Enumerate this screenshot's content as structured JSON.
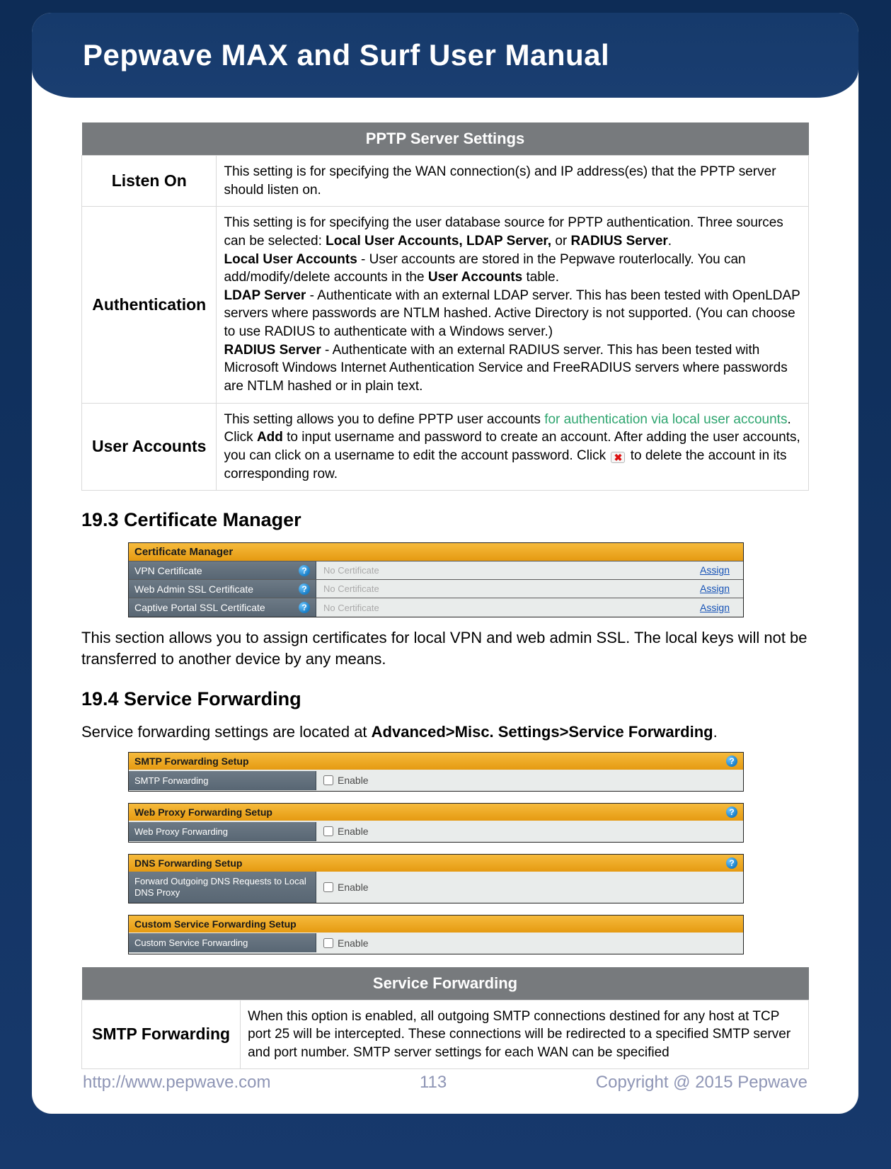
{
  "header": {
    "title": "Pepwave MAX and Surf User Manual"
  },
  "pptp_table": {
    "title": "PPTP Server Settings",
    "rows": {
      "listen_on": {
        "label": "Listen On",
        "text": "This setting is for specifying the WAN connection(s) and IP address(es) that the PPTP server should listen on."
      },
      "authentication": {
        "label": "Authentication",
        "intro": "This setting is for specifying the user database source for PPTP authentication. Three sources can be selected: ",
        "bold_sources": "Local User Accounts, LDAP Server,",
        "or_word": " or ",
        "bold_radius": "RADIUS Server",
        "period": ".",
        "local_label": "Local User Accounts",
        "local_text": " - User accounts are stored in the Pepwave routerlocally. You can add/modify/delete accounts in the ",
        "local_bold2": "User Accounts",
        "local_tail": " table.",
        "ldap_label": "LDAP Server",
        "ldap_text": " - Authenticate with an external LDAP server. This has been tested with OpenLDAP servers where passwords are NTLM hashed. Active Directory is not supported. (You can choose to use RADIUS to authenticate with a Windows server.)",
        "radius_label": "RADIUS Server",
        "radius_text": " - Authenticate with an external RADIUS server. This has been tested with Microsoft Windows Internet Authentication Service and FreeRADIUS servers where passwords are NTLM hashed or in plain text."
      },
      "user_accounts": {
        "label": "User Accounts",
        "pre": "This setting allows you to define PPTP user accounts ",
        "green": "for authentication via local user accounts",
        "post1": ". Click ",
        "add_bold": "Add",
        "post2": " to input username and password to create an account. After adding the user accounts, you can click on a username to edit the account password. Click ",
        "post3": " to delete the account in its corresponding row."
      }
    }
  },
  "section_193": {
    "heading": "19.3   Certificate Manager",
    "cert_title": "Certificate Manager",
    "rows": [
      {
        "label": "VPN Certificate",
        "value": "No Certificate",
        "action": "Assign"
      },
      {
        "label": "Web Admin SSL Certificate",
        "value": "No Certificate",
        "action": "Assign"
      },
      {
        "label": "Captive Portal SSL Certificate",
        "value": "No Certificate",
        "action": "Assign"
      }
    ],
    "paragraph": "This section allows you to assign certificates for local VPN and web admin SSL. The local keys will not be transferred to another device by any means."
  },
  "section_194": {
    "heading": "19.4   Service Forwarding",
    "intro_pre": "Service forwarding settings are located at ",
    "intro_bold": "Advanced>Misc. Settings>Service Forwarding",
    "intro_post": ".",
    "groups": [
      {
        "title": "SMTP Forwarding Setup",
        "row_label": "SMTP Forwarding",
        "enable_label": "Enable",
        "help": true
      },
      {
        "title": "Web Proxy Forwarding Setup",
        "row_label": "Web Proxy Forwarding",
        "enable_label": "Enable",
        "help": true
      },
      {
        "title": "DNS Forwarding Setup",
        "row_label": "Forward Outgoing DNS Requests to Local DNS Proxy",
        "enable_label": "Enable",
        "help": true
      },
      {
        "title": "Custom Service Forwarding Setup",
        "row_label": "Custom Service Forwarding",
        "enable_label": "Enable",
        "help": false
      }
    ]
  },
  "svc_table": {
    "title": "Service Forwarding",
    "row": {
      "label": "SMTP Forwarding",
      "text": "When this option is enabled, all outgoing SMTP connections destined for any host at TCP port 25 will be intercepted. These connections will be redirected to a specified SMTP server and port number. SMTP server settings for each WAN can be specified"
    }
  },
  "footer": {
    "url": "http://www.pepwave.com",
    "page": "113",
    "copyright": "Copyright @ 2015 Pepwave"
  }
}
